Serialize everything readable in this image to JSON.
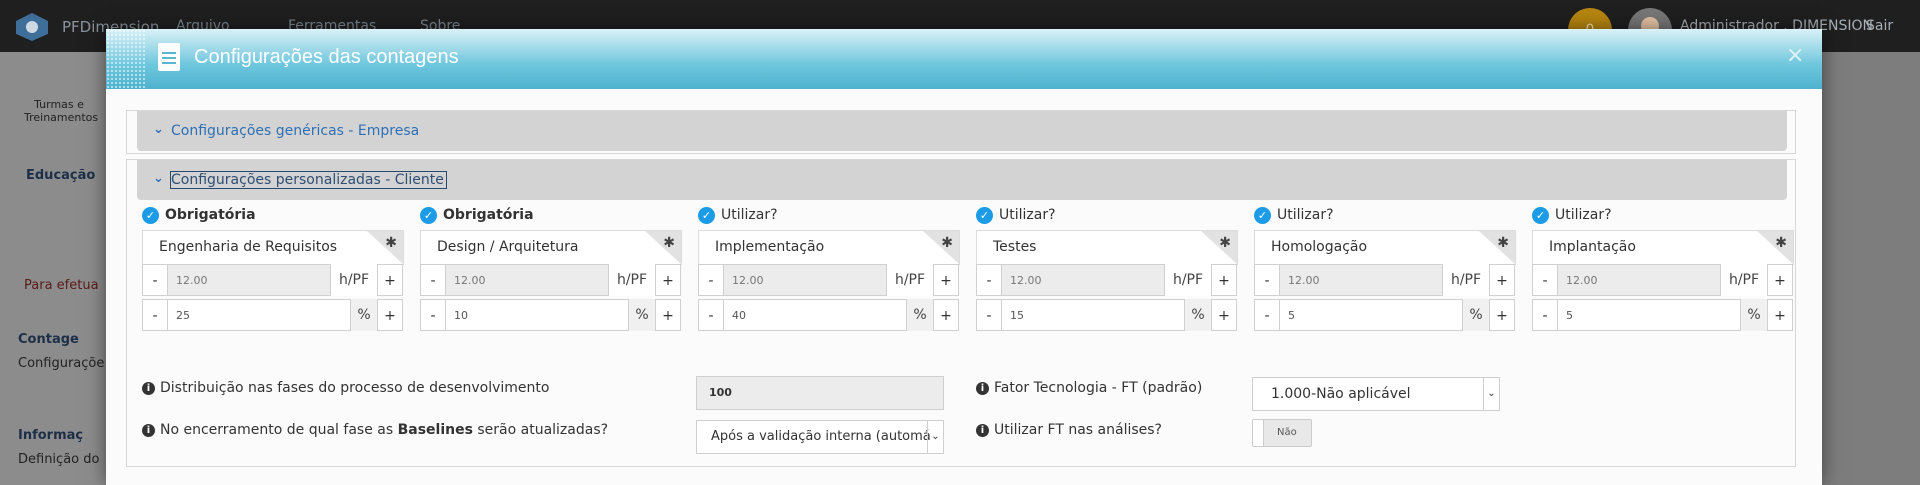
{
  "app": {
    "brand": "PFDimension",
    "menu": [
      "Arquivo",
      "Ferramentas",
      "Sobre"
    ],
    "notification_count": "0",
    "user": "Administrador . DIMENSION",
    "logout": "Sair"
  },
  "background": {
    "side_item": "Turmas e Treinamentos",
    "tab": "Educação",
    "alert": "Para efetua",
    "link1": "Contage",
    "text1": "Configuraçõe",
    "link2": "Informaç",
    "text2": "Definição do"
  },
  "modal": {
    "title": "Configurações das contagens",
    "close": "×",
    "section_generic": "Configurações genéricas - Empresa",
    "section_custom": "Configurações personalizadas - Cliente",
    "phases": [
      {
        "check_label": "Obrigatória",
        "bold": true,
        "name": "Engenharia de Requisitos",
        "hours": "12.00",
        "hours_unit": "h/PF",
        "percent": "25",
        "percent_unit": "%"
      },
      {
        "check_label": "Obrigatória",
        "bold": true,
        "name": "Design / Arquitetura",
        "hours": "12.00",
        "hours_unit": "h/PF",
        "percent": "10",
        "percent_unit": "%"
      },
      {
        "check_label": "Utilizar?",
        "bold": false,
        "name": "Implementação",
        "hours": "12.00",
        "hours_unit": "h/PF",
        "percent": "40",
        "percent_unit": "%"
      },
      {
        "check_label": "Utilizar?",
        "bold": false,
        "name": "Testes",
        "hours": "12.00",
        "hours_unit": "h/PF",
        "percent": "15",
        "percent_unit": "%"
      },
      {
        "check_label": "Utilizar?",
        "bold": false,
        "name": "Homologação",
        "hours": "12.00",
        "hours_unit": "h/PF",
        "percent": "5",
        "percent_unit": "%"
      },
      {
        "check_label": "Utilizar?",
        "bold": false,
        "name": "Implantação",
        "hours": "12.00",
        "hours_unit": "h/PF",
        "percent": "5",
        "percent_unit": "%"
      }
    ],
    "minus": "-",
    "plus": "+",
    "asterisk": "✱",
    "distribution_label": "Distribuição nas fases do processo de desenvolvimento",
    "distribution_value": "100",
    "baseline_label_pre": "No encerramento de qual fase as ",
    "baseline_label_bold": "Baselines",
    "baseline_label_post": " serão atualizadas?",
    "baseline_value": "Após a validação interna (automá",
    "ft_label": "Fator Tecnologia - FT (padrão)",
    "ft_value": "1.000-Não aplicável",
    "use_ft_label": "Utilizar FT nas análises?",
    "use_ft_value": "Não"
  },
  "colors": {
    "accent": "#4fb3ce",
    "link": "#2e70b6",
    "check": "#1c9be6"
  }
}
